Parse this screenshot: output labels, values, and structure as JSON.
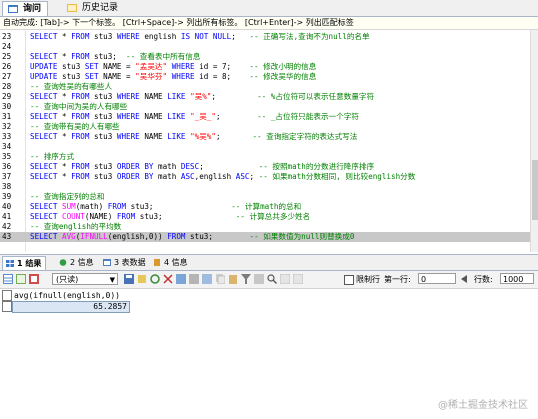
{
  "tabs": [
    {
      "label": "询问",
      "active": true,
      "icon": "query-icon"
    },
    {
      "label": "历史记录",
      "active": false,
      "icon": "history-icon"
    }
  ],
  "hint": "自动完成: [Tab]-> 下一个标签。 [Ctrl+Space]-> 列出所有标签。 [Ctrl+Enter]-> 列出匹配标签",
  "editor": {
    "lines": [
      {
        "num": "23",
        "segs": [
          [
            "kw",
            "SELECT"
          ],
          [
            "txt",
            " * "
          ],
          [
            "kw",
            "FROM"
          ],
          [
            "txt",
            " stu3 "
          ],
          [
            "kw",
            "WHERE"
          ],
          [
            "txt",
            " english "
          ],
          [
            "kw",
            "IS NOT NULL"
          ],
          [
            "txt",
            ";   "
          ],
          [
            "cmt",
            "-- 正确写法,查询不为null的名单"
          ]
        ]
      },
      {
        "num": "24",
        "segs": []
      },
      {
        "num": "25",
        "segs": [
          [
            "kw",
            "SELECT"
          ],
          [
            "txt",
            " * "
          ],
          [
            "kw",
            "FROM"
          ],
          [
            "txt",
            " stu3;  "
          ],
          [
            "cmt",
            "-- 查看表中所有信息"
          ]
        ]
      },
      {
        "num": "26",
        "segs": [
          [
            "kw",
            "UPDATE"
          ],
          [
            "txt",
            " stu3 "
          ],
          [
            "kw",
            "SET"
          ],
          [
            "txt",
            " NAME = "
          ],
          [
            "str",
            "\"孟吴达\""
          ],
          [
            "txt",
            " "
          ],
          [
            "kw",
            "WHERE"
          ],
          [
            "txt",
            " id = 7;    "
          ],
          [
            "cmt",
            "-- 修改小明的信息"
          ]
        ]
      },
      {
        "num": "27",
        "segs": [
          [
            "kw",
            "UPDATE"
          ],
          [
            "txt",
            " stu3 "
          ],
          [
            "kw",
            "SET"
          ],
          [
            "txt",
            " NAME = "
          ],
          [
            "str",
            "\"吴华芬\""
          ],
          [
            "txt",
            " "
          ],
          [
            "kw",
            "WHERE"
          ],
          [
            "txt",
            " id = 8;    "
          ],
          [
            "cmt",
            "-- 修改吴华的信息"
          ]
        ]
      },
      {
        "num": "28",
        "segs": [
          [
            "cmt",
            "-- 查询姓吴的有哪些人"
          ]
        ]
      },
      {
        "num": "29",
        "segs": [
          [
            "kw",
            "SELECT"
          ],
          [
            "txt",
            " * "
          ],
          [
            "kw",
            "FROM"
          ],
          [
            "txt",
            " stu3 "
          ],
          [
            "kw",
            "WHERE"
          ],
          [
            "txt",
            " NAME "
          ],
          [
            "kw",
            "LIKE"
          ],
          [
            "txt",
            " "
          ],
          [
            "str",
            "\"吴%\""
          ],
          [
            "txt",
            ";         "
          ],
          [
            "cmt",
            "-- %占位符可以表示任意数量字符"
          ]
        ]
      },
      {
        "num": "30",
        "segs": [
          [
            "cmt",
            "-- 查询中间为吴的人有哪些"
          ]
        ]
      },
      {
        "num": "31",
        "segs": [
          [
            "kw",
            "SELECT"
          ],
          [
            "txt",
            " * "
          ],
          [
            "kw",
            "FROM"
          ],
          [
            "txt",
            " stu3 "
          ],
          [
            "kw",
            "WHERE"
          ],
          [
            "txt",
            " NAME "
          ],
          [
            "kw",
            "LIKE"
          ],
          [
            "txt",
            " "
          ],
          [
            "str",
            "\"_吴_\""
          ],
          [
            "txt",
            ";        "
          ],
          [
            "cmt",
            "-- _占位符只能表示一个字符"
          ]
        ]
      },
      {
        "num": "32",
        "segs": [
          [
            "cmt",
            "-- 查询带有吴的人有哪些"
          ]
        ]
      },
      {
        "num": "33",
        "segs": [
          [
            "kw",
            "SELECT"
          ],
          [
            "txt",
            " * "
          ],
          [
            "kw",
            "FROM"
          ],
          [
            "txt",
            " stu3 "
          ],
          [
            "kw",
            "WHERE"
          ],
          [
            "txt",
            " NAME "
          ],
          [
            "kw",
            "LIKE"
          ],
          [
            "txt",
            " "
          ],
          [
            "str",
            "\"%吴%\""
          ],
          [
            "txt",
            ";       "
          ],
          [
            "cmt",
            "-- 查询指定字符的表达式写法"
          ]
        ]
      },
      {
        "num": "34",
        "segs": []
      },
      {
        "num": "35",
        "segs": [
          [
            "cmt",
            "-- 排序方式"
          ]
        ]
      },
      {
        "num": "36",
        "segs": [
          [
            "kw",
            "SELECT"
          ],
          [
            "txt",
            " * "
          ],
          [
            "kw",
            "FROM"
          ],
          [
            "txt",
            " stu3 "
          ],
          [
            "kw",
            "ORDER BY"
          ],
          [
            "txt",
            " math "
          ],
          [
            "kw",
            "DESC"
          ],
          [
            "txt",
            ";            "
          ],
          [
            "cmt",
            "-- 按照math的分数进行降序排序"
          ]
        ]
      },
      {
        "num": "37",
        "segs": [
          [
            "kw",
            "SELECT"
          ],
          [
            "txt",
            " * "
          ],
          [
            "kw",
            "FROM"
          ],
          [
            "txt",
            " stu3 "
          ],
          [
            "kw",
            "ORDER BY"
          ],
          [
            "txt",
            " math "
          ],
          [
            "kw",
            "ASC"
          ],
          [
            "txt",
            ",english "
          ],
          [
            "kw",
            "ASC"
          ],
          [
            "txt",
            "; "
          ],
          [
            "cmt",
            "-- 如果math分数相同, 则比较english分数"
          ]
        ]
      },
      {
        "num": "38",
        "segs": []
      },
      {
        "num": "39",
        "segs": [
          [
            "cmt",
            "-- 查询指定列的总和"
          ]
        ]
      },
      {
        "num": "40",
        "segs": [
          [
            "kw",
            "SELECT"
          ],
          [
            "txt",
            " "
          ],
          [
            "fn",
            "SUM"
          ],
          [
            "txt",
            "(math) "
          ],
          [
            "kw",
            "FROM"
          ],
          [
            "txt",
            " stu3;                 "
          ],
          [
            "cmt",
            "-- 计算math的总和"
          ]
        ]
      },
      {
        "num": "41",
        "segs": [
          [
            "kw",
            "SELECT"
          ],
          [
            "txt",
            " "
          ],
          [
            "fn",
            "COUNT"
          ],
          [
            "txt",
            "(NAME) "
          ],
          [
            "kw",
            "FROM"
          ],
          [
            "txt",
            " stu3;                "
          ],
          [
            "cmt",
            "-- 计算总共多少姓名"
          ]
        ]
      },
      {
        "num": "42",
        "segs": [
          [
            "cmt",
            "-- 查询english的平均数"
          ]
        ]
      },
      {
        "num": "43",
        "segs": [
          [
            "kw",
            "SELECT"
          ],
          [
            "txt",
            " "
          ],
          [
            "fn",
            "AVG"
          ],
          [
            "txt",
            "("
          ],
          [
            "fn",
            "IFNULL"
          ],
          [
            "txt",
            "(english,0)) "
          ],
          [
            "kw",
            "FROM"
          ],
          [
            "txt",
            " stu3;        "
          ],
          [
            "cmt",
            "-- 如果数值为null则替换成0"
          ]
        ],
        "highlight": true
      }
    ]
  },
  "result_tabs": [
    {
      "label": "1 结果",
      "active": true,
      "icon": "result-grid-icon"
    },
    {
      "label": "2 信息",
      "active": false,
      "icon": "info-icon"
    },
    {
      "label": "3 表数据",
      "active": false,
      "icon": "table-data-icon"
    },
    {
      "label": "4 信息",
      "active": false,
      "icon": "info-icon"
    }
  ],
  "toolbar": {
    "readonly_select": "(只读)",
    "limit_rows_label": "限制行",
    "first_row_label": "第一行:",
    "first_row_value": "0",
    "rows_label": "行数:",
    "rows_value": "1000"
  },
  "grid": {
    "column": "avg(ifnull(english,0))",
    "rows": [
      "65.2857"
    ]
  },
  "watermark": "@稀土掘金技术社区"
}
